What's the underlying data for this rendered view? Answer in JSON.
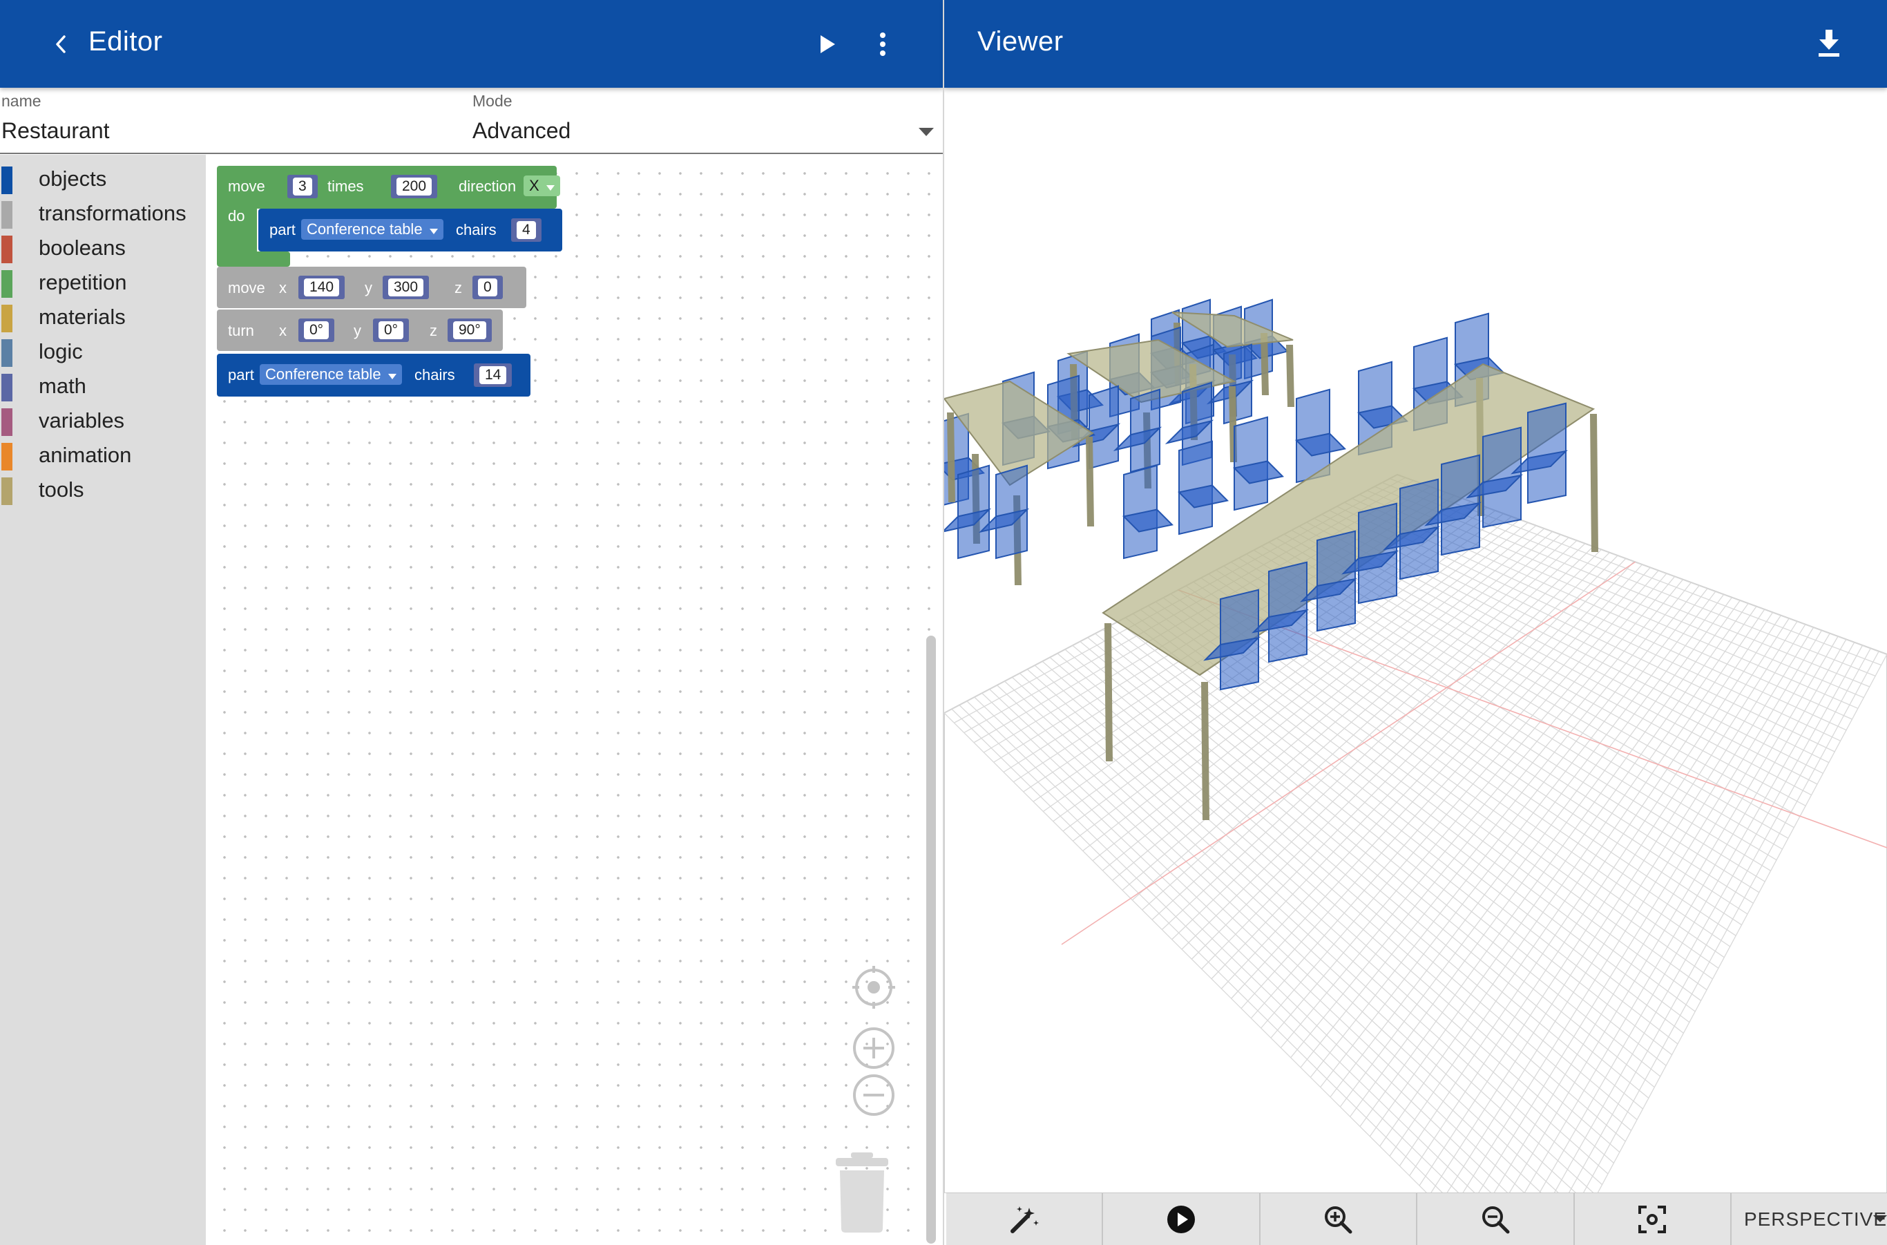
{
  "editor": {
    "title": "Editor",
    "name_label": "name",
    "name_value": "Restaurant",
    "mode_label": "Mode",
    "mode_value": "Advanced"
  },
  "viewer": {
    "title": "Viewer",
    "projection": "PERSPECTIVE"
  },
  "toolbox": {
    "items": [
      {
        "label": "objects",
        "color": "#0d4fa5"
      },
      {
        "label": "transformations",
        "color": "#a9a9a9"
      },
      {
        "label": "booleans",
        "color": "#c0533e"
      },
      {
        "label": "repetition",
        "color": "#5ba55b"
      },
      {
        "label": "materials",
        "color": "#c9a443"
      },
      {
        "label": "logic",
        "color": "#5b80a5"
      },
      {
        "label": "math",
        "color": "#5b67a5"
      },
      {
        "label": "variables",
        "color": "#a55b80"
      },
      {
        "label": "animation",
        "color": "#e9872a"
      },
      {
        "label": "tools",
        "color": "#b3a46c"
      }
    ]
  },
  "blocks": {
    "repeat": {
      "label": "move",
      "count": "3",
      "times_label": "times",
      "step": "200",
      "direction_label": "direction",
      "direction": "X",
      "do_label": "do"
    },
    "inner_part": {
      "label": "part",
      "model": "Conference table",
      "chairs_label": "chairs",
      "chairs": "4"
    },
    "move": {
      "label": "move",
      "x_label": "x",
      "x": "140",
      "y_label": "y",
      "y": "300",
      "z_label": "z",
      "z": "0"
    },
    "turn": {
      "label": "turn",
      "x_label": "x",
      "x": "0°",
      "y_label": "y",
      "y": "0°",
      "z_label": "z",
      "z": "90°"
    },
    "part": {
      "label": "part",
      "model": "Conference table",
      "chairs_label": "chairs",
      "chairs": "14"
    }
  },
  "colors": {
    "appbar": "#0d4fa5",
    "block_objects": "#0d4fa5",
    "block_repetition": "#5ba55b",
    "block_transform": "#a9a9a9",
    "table_top": "#b7b58a",
    "chair": "#2f63c7"
  }
}
